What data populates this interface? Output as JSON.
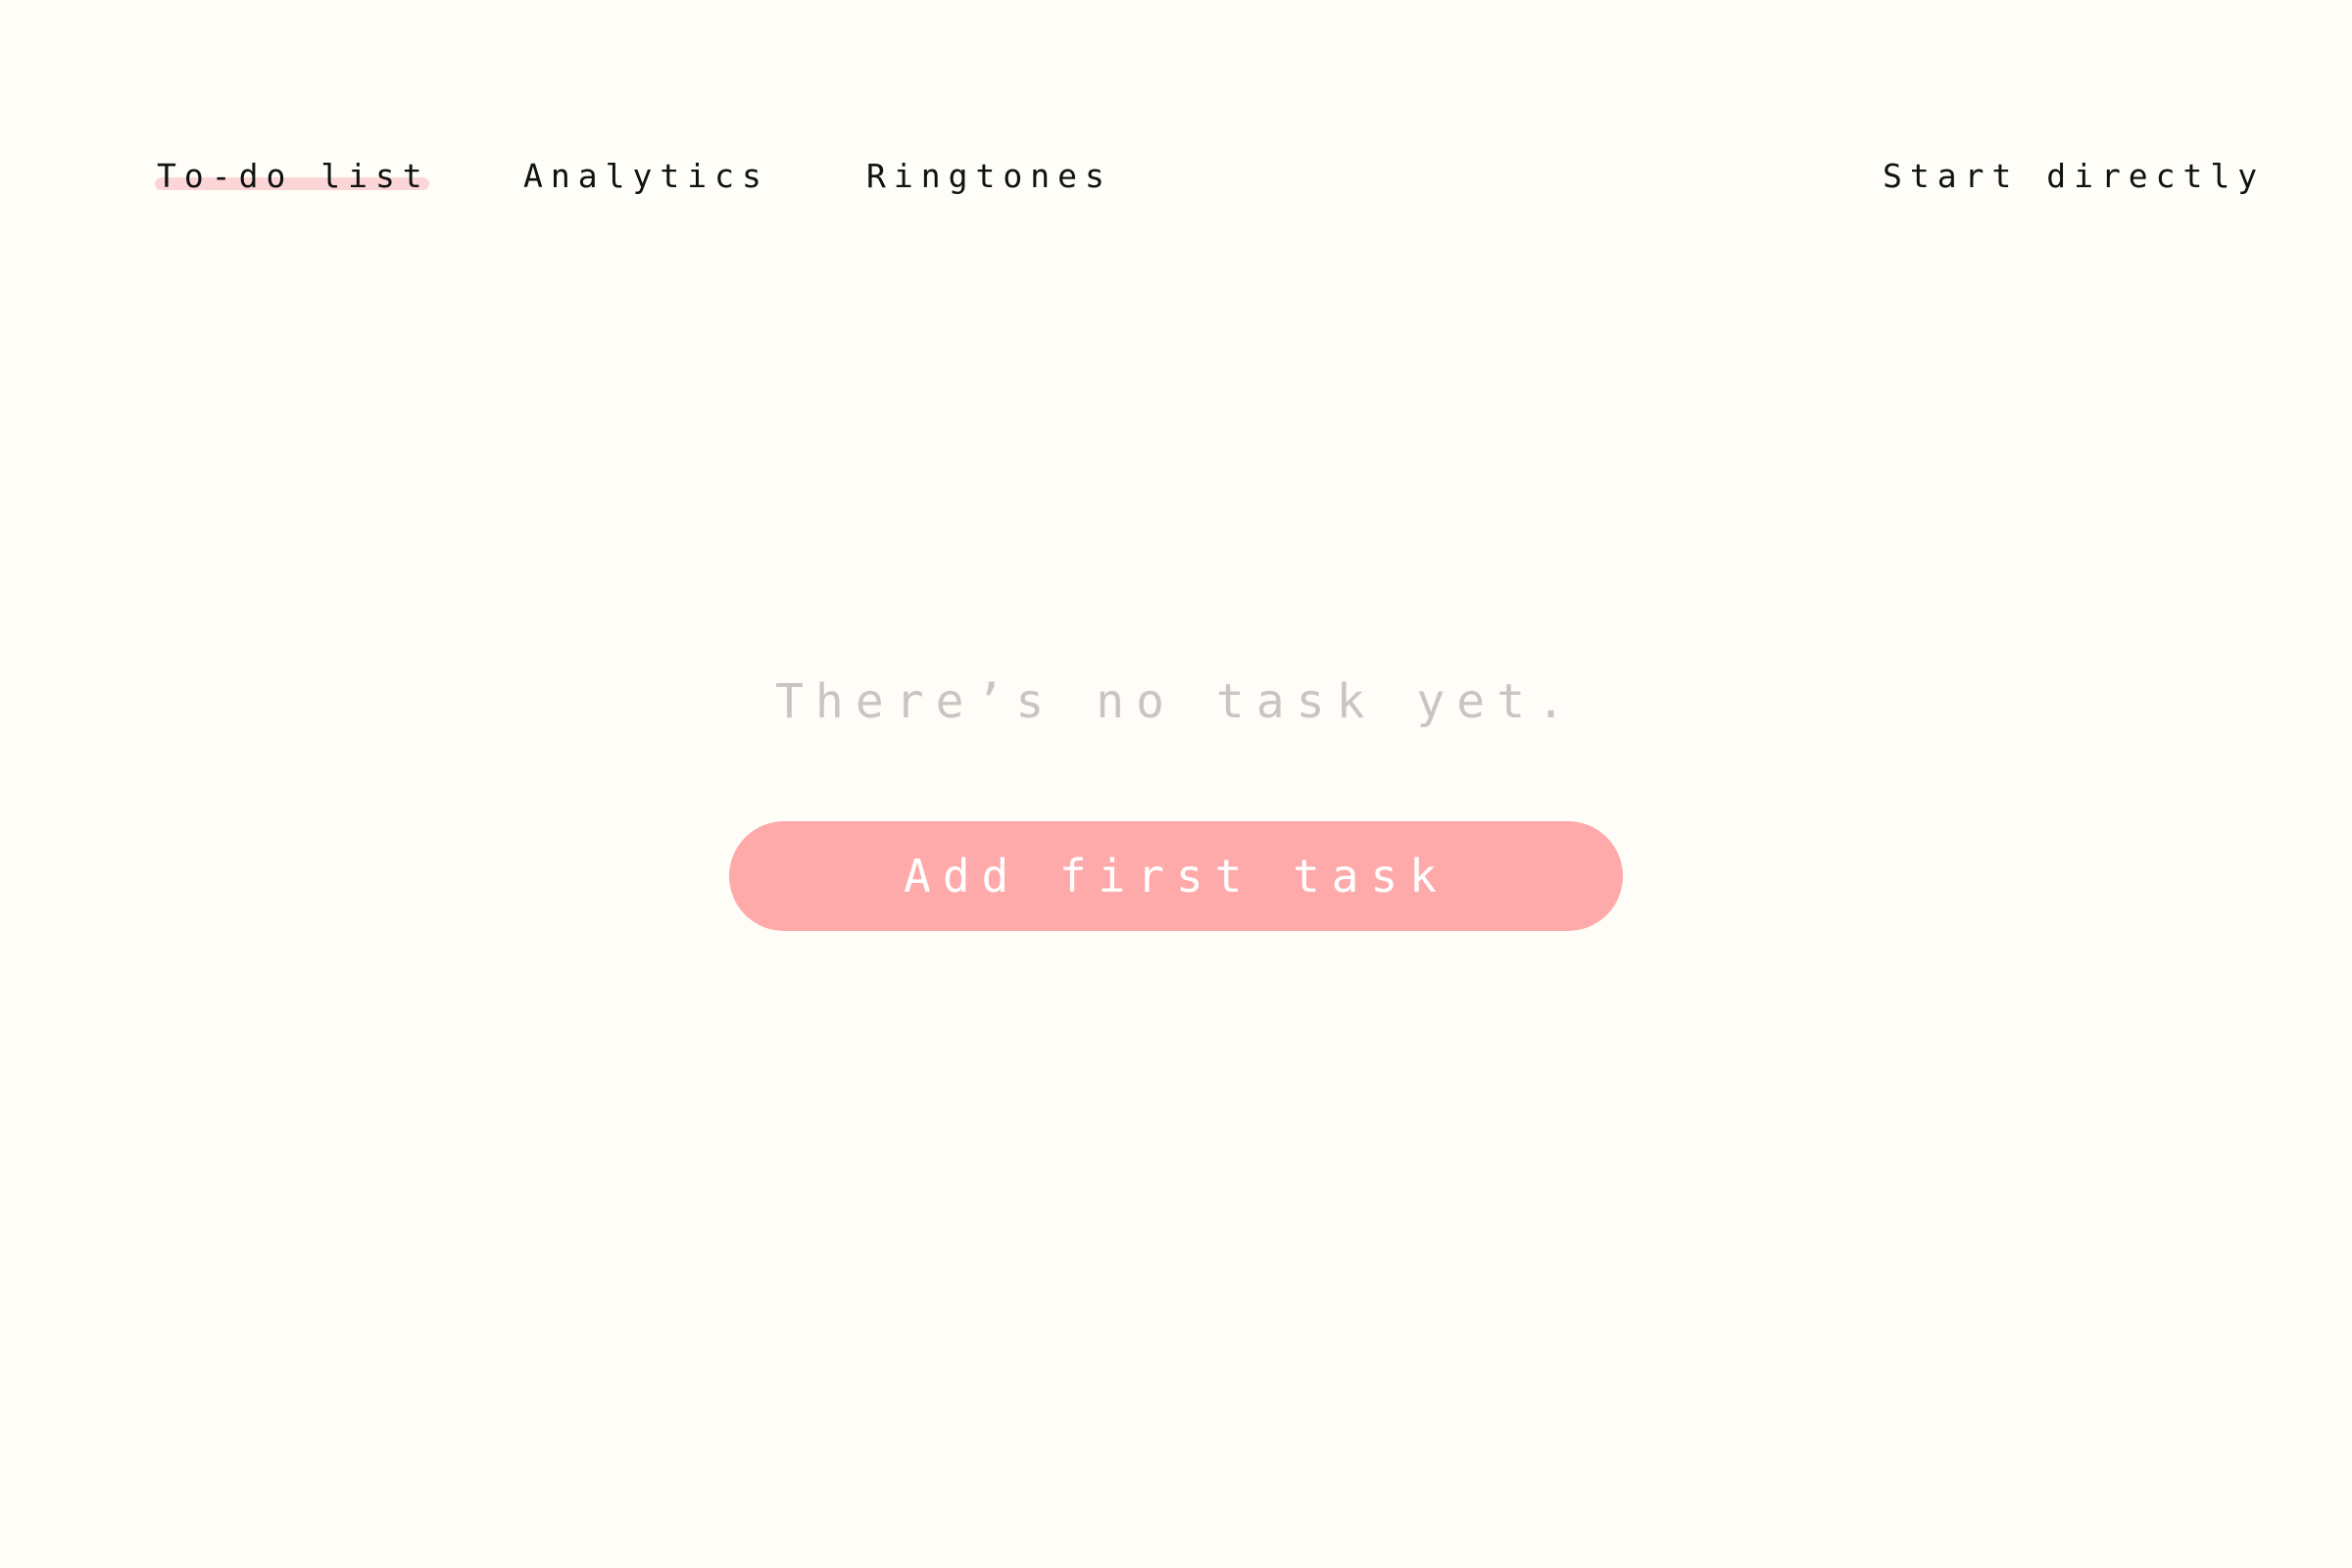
{
  "nav": {
    "items": [
      {
        "label": "To-do list",
        "active": true
      },
      {
        "label": "Analytics",
        "active": false
      },
      {
        "label": "Ringtones",
        "active": false
      }
    ],
    "start_label": "Start directly"
  },
  "main": {
    "empty_message": "There’s no task yet.",
    "add_button_label": "Add first task"
  },
  "colors": {
    "background": "#fffdf8",
    "accent": "#ffaaaa",
    "active_underline": "#fcd6d6",
    "muted_text": "#c8c6c2"
  }
}
